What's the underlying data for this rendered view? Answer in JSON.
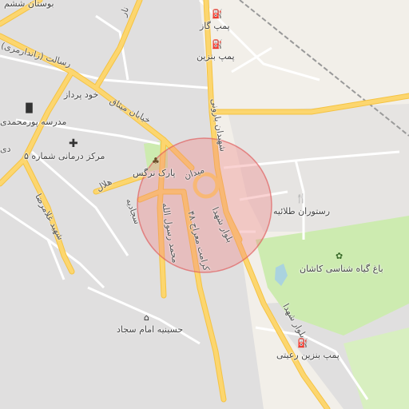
{
  "map": {
    "colors": {
      "background": "#f2efe9",
      "residential": "#e0dfdf",
      "park": "#cdebb0",
      "major_road": "#fcd66f",
      "minor_road": "#ffffff",
      "highlight_circle": "#f08080",
      "water": "#aad3df"
    },
    "pois": [
      {
        "name": "پمپ گاز",
        "icon": "fuel-pump-icon"
      },
      {
        "name": "پمپ بنزین",
        "icon": "fuel-pump-icon"
      },
      {
        "name": "مدرسه پورمحمدی",
        "icon": "school-icon"
      },
      {
        "name": "مرکز درمانی شماره ۵",
        "icon": "medical-cross-icon"
      },
      {
        "name": "پارک نرگس",
        "icon": "tree-icon"
      },
      {
        "name": "رستوران طلائیه",
        "icon": "restaurant-icon"
      },
      {
        "name": "باغ گیاه شناسی کاشان",
        "icon": "garden-icon"
      },
      {
        "name": "حسینیه امام سجاد",
        "icon": "place-of-worship-icon"
      },
      {
        "name": "پمپ بنزین رعیتی",
        "icon": "fuel-pump-icon"
      }
    ],
    "labels": {
      "bostan": "بوستان ششم",
      "khod_pardaz": "خود پرداز",
      "resalat": "رسالت (زاندارمری)",
      "khiaban_mishagh": "خیابان میثاق",
      "shahid_gholamreza": "شهید غلامرضا",
      "sajjadieh": "سجادیه",
      "mohammad_rasoolallah": "محمد رسول الله",
      "karamat_meraj": "کرامت معراج ۴۸",
      "meydan": "میدان",
      "bolvar_shohada_1": "بلوار شهدا",
      "bolvar_shohada_2": "بلوار شهدا",
      "shahidan_baroodi": "شهیدان بارونی",
      "helal": "هلال",
      "de": "دی",
      "nar": "نار"
    }
  }
}
